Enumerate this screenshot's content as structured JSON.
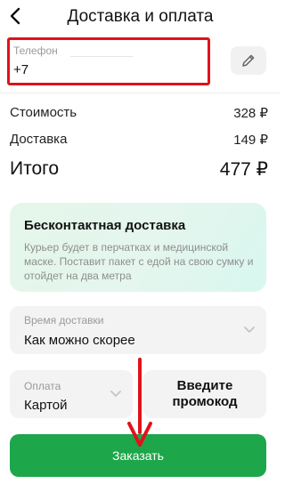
{
  "header": {
    "title": "Доставка и оплата",
    "back_icon": "chevron-left-icon"
  },
  "phone": {
    "label": "Телефон",
    "value": "+7",
    "highlight_color": "#e0121a",
    "edit_icon": "pencil-icon"
  },
  "summary": {
    "cost_label": "Стоимость",
    "cost_value": "328 ₽",
    "delivery_label": "Доставка",
    "delivery_value": "149 ₽",
    "total_label": "Итого",
    "total_value": "477 ₽"
  },
  "contactless": {
    "title": "Бесконтактная доставка",
    "text": "Курьер будет в перчатках и медицинской маске. Поставит пакет с едой на свою сумку и отойдет на два метра"
  },
  "delivery_time": {
    "label": "Время доставки",
    "value": "Как можно скорее",
    "icon": "chevron-down-icon"
  },
  "payment": {
    "label": "Оплата",
    "value": "Картой",
    "icon": "chevron-down-icon"
  },
  "promo_code": {
    "label": "Введите промокод"
  },
  "order_button": {
    "label": "Заказать",
    "color": "#1ea64a"
  },
  "annotation": {
    "arrow_color": "#e0121a",
    "icon": "arrow-down-icon"
  }
}
